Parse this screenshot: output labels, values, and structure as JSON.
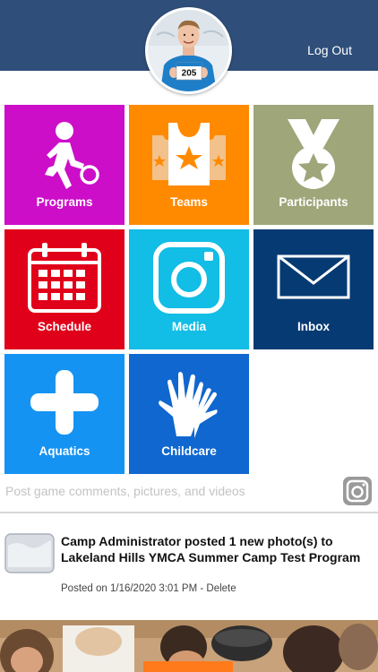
{
  "header": {
    "logout_label": "Log Out",
    "bib_number": "205",
    "bg_color": "#2f4f7a"
  },
  "tiles": [
    {
      "label": "Programs",
      "icon": "person-kicking-ball-icon",
      "color": "#cc0ec9"
    },
    {
      "label": "Teams",
      "icon": "jersey-star-icon",
      "color": "#ff8a00"
    },
    {
      "label": "Participants",
      "icon": "medal-icon",
      "color": "#9ea67a"
    },
    {
      "label": "Schedule",
      "icon": "calendar-icon",
      "color": "#e0001a"
    },
    {
      "label": "Media",
      "icon": "camera-icon",
      "color": "#12bde6"
    },
    {
      "label": "Inbox",
      "icon": "envelope-icon",
      "color": "#063a73"
    },
    {
      "label": "Aquatics",
      "icon": "plus-icon",
      "color": "#1593f3"
    },
    {
      "label": "Childcare",
      "icon": "hands-icon",
      "color": "#1067cf"
    }
  ],
  "post": {
    "placeholder": "Post game comments, pictures, and videos",
    "camera_icon": "camera-icon"
  },
  "feed": [
    {
      "title": "Camp Administrator posted 1 new photo(s) to Lakeland Hills YMCA Summer Camp Test Program",
      "posted_on": "Posted on 1/16/2020 3:01 PM",
      "separator": " - ",
      "delete_label": "Delete",
      "thumb_icon": "photo-placeholder-icon"
    }
  ]
}
